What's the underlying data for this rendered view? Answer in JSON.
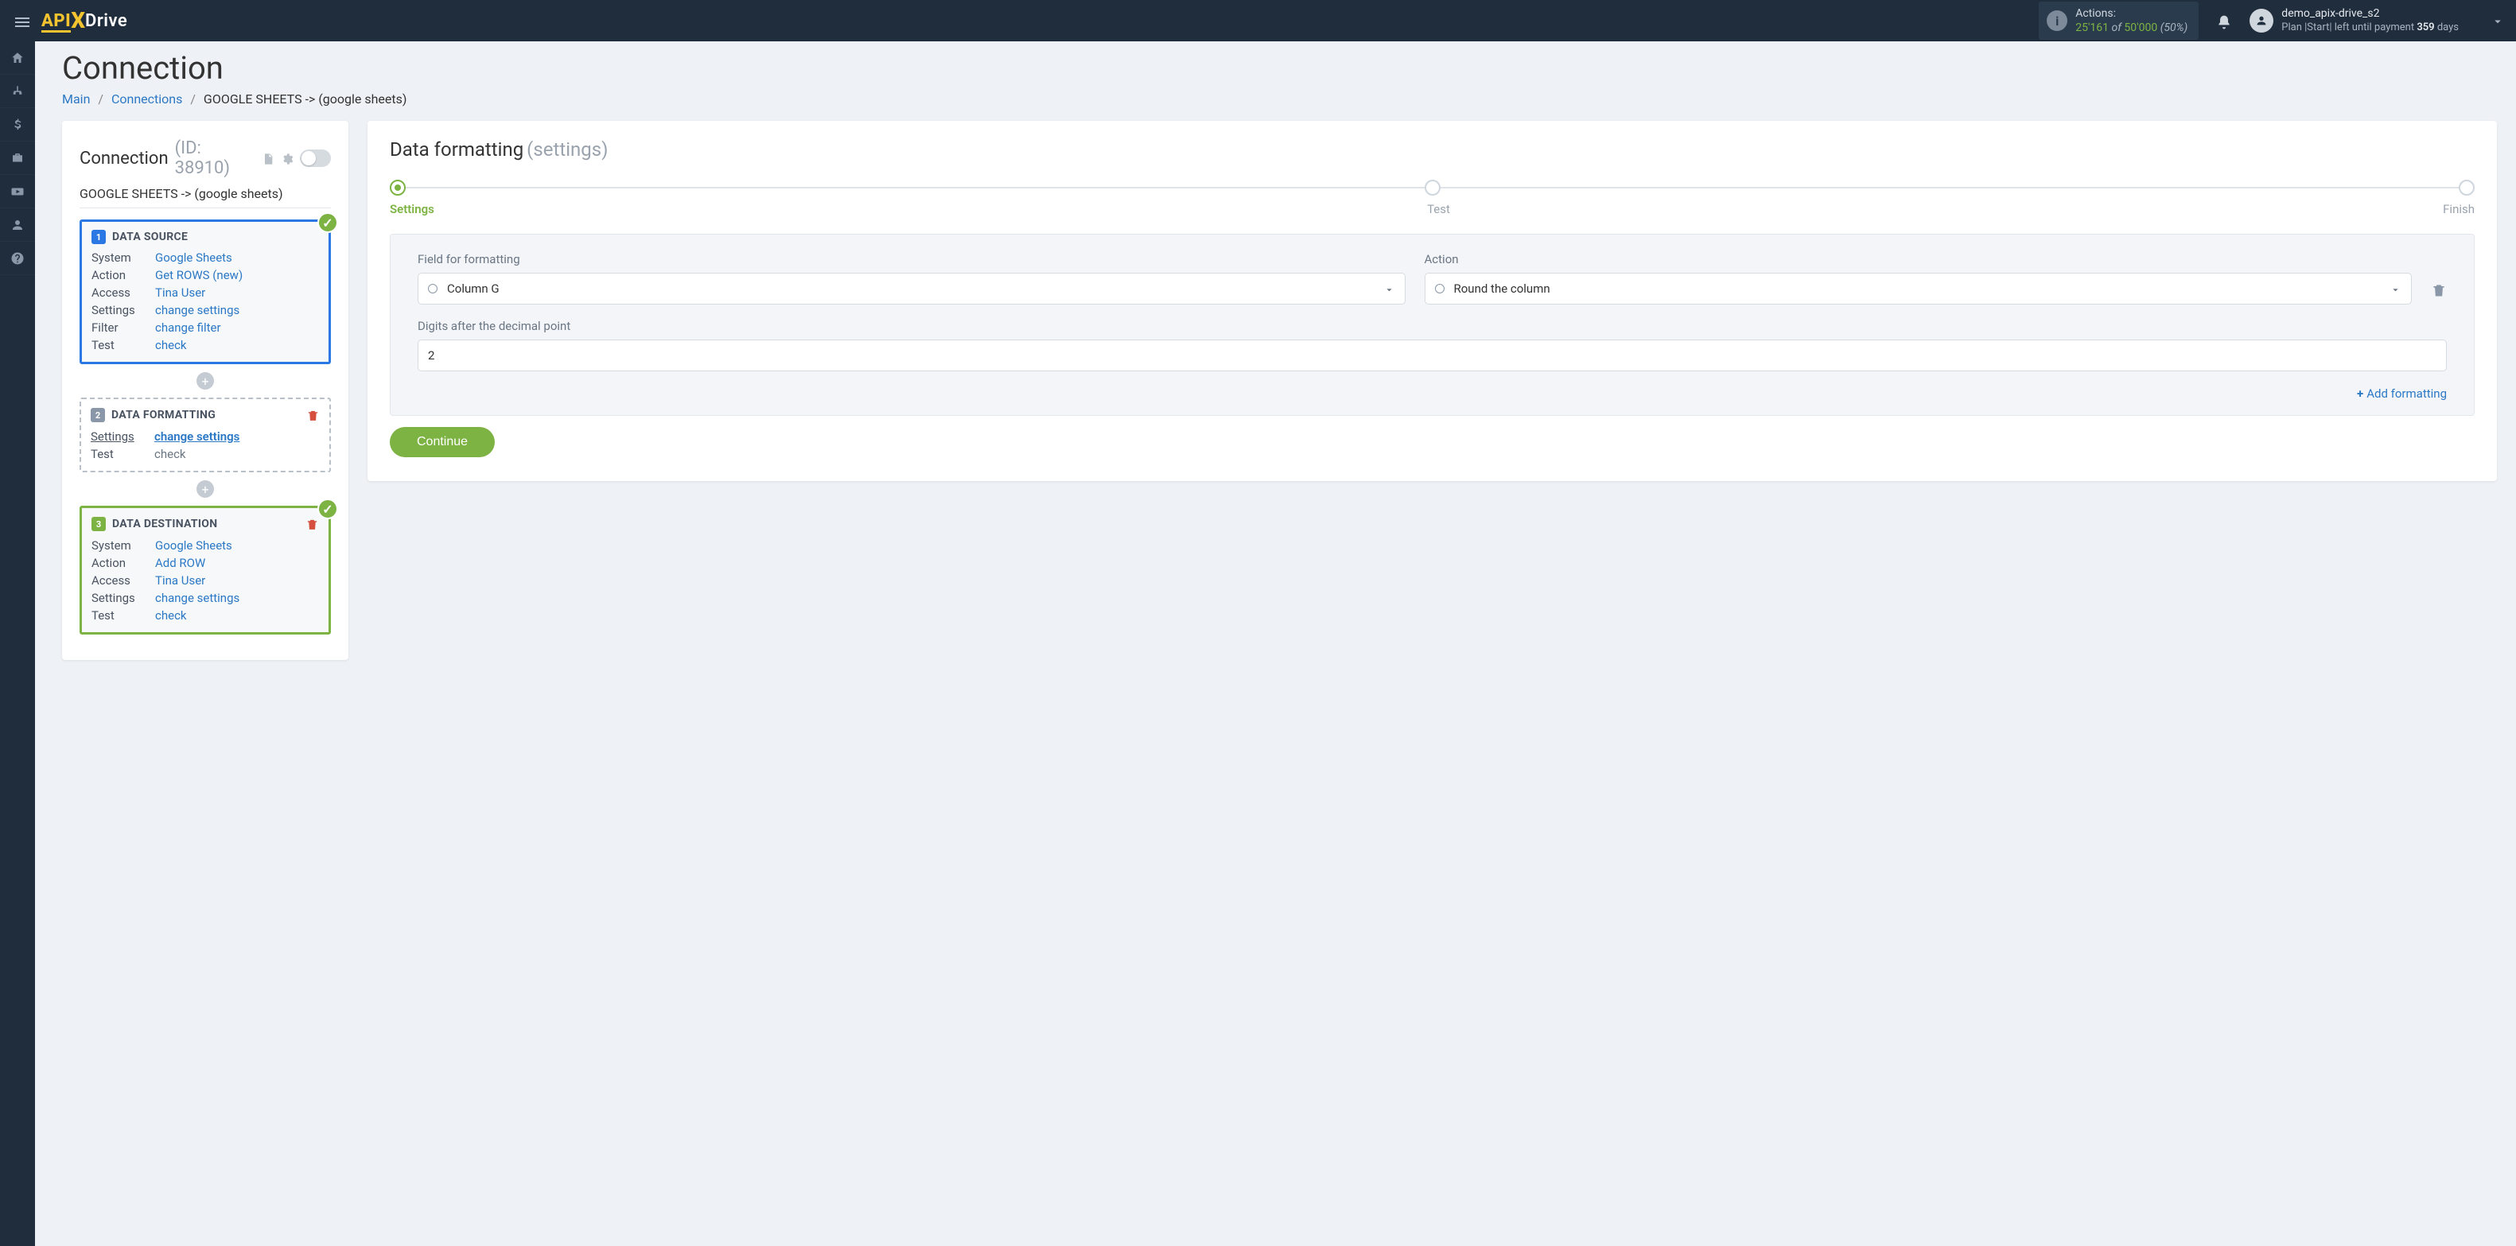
{
  "topbar": {
    "actions_label": "Actions:",
    "actions_count": "25'161",
    "actions_of": "of",
    "actions_limit": "50'000",
    "actions_pct": "(50%)",
    "username": "demo_apix-drive_s2",
    "plan_prefix": "Plan |Start| left until payment",
    "plan_days_number": "359",
    "plan_days_suffix": "days"
  },
  "breadcrumb": {
    "main": "Main",
    "connections": "Connections",
    "current": "GOOGLE SHEETS -> (google sheets)"
  },
  "page": {
    "title": "Connection",
    "conn_title": "Connection",
    "conn_id": "(ID: 38910)",
    "conn_name": "GOOGLE SHEETS -> (google sheets)"
  },
  "steps": {
    "source": {
      "num": "1",
      "title": "DATA SOURCE",
      "rows": {
        "system_label": "System",
        "system_value": "Google Sheets",
        "action_label": "Action",
        "action_value": "Get ROWS (new)",
        "access_label": "Access",
        "access_value": "Tina User",
        "settings_label": "Settings",
        "settings_value": "change settings",
        "filter_label": "Filter",
        "filter_value": "change filter",
        "test_label": "Test",
        "test_value": "check"
      }
    },
    "formatting": {
      "num": "2",
      "title": "DATA FORMATTING",
      "rows": {
        "settings_label": "Settings",
        "settings_value": "change settings",
        "test_label": "Test",
        "test_value": "check"
      }
    },
    "destination": {
      "num": "3",
      "title": "DATA DESTINATION",
      "rows": {
        "system_label": "System",
        "system_value": "Google Sheets",
        "action_label": "Action",
        "action_value": "Add ROW",
        "access_label": "Access",
        "access_value": "Tina User",
        "settings_label": "Settings",
        "settings_value": "change settings",
        "test_label": "Test",
        "test_value": "check"
      }
    }
  },
  "right": {
    "heading": "Data formatting",
    "subheading": "(settings)",
    "stepper": {
      "settings": "Settings",
      "test": "Test",
      "finish": "Finish"
    },
    "field_label": "Field for formatting",
    "field_value": "Column G",
    "action_label": "Action",
    "action_value": "Round the column",
    "digits_label": "Digits after the decimal point",
    "digits_value": "2",
    "add_formatting": "Add formatting",
    "continue": "Continue"
  }
}
